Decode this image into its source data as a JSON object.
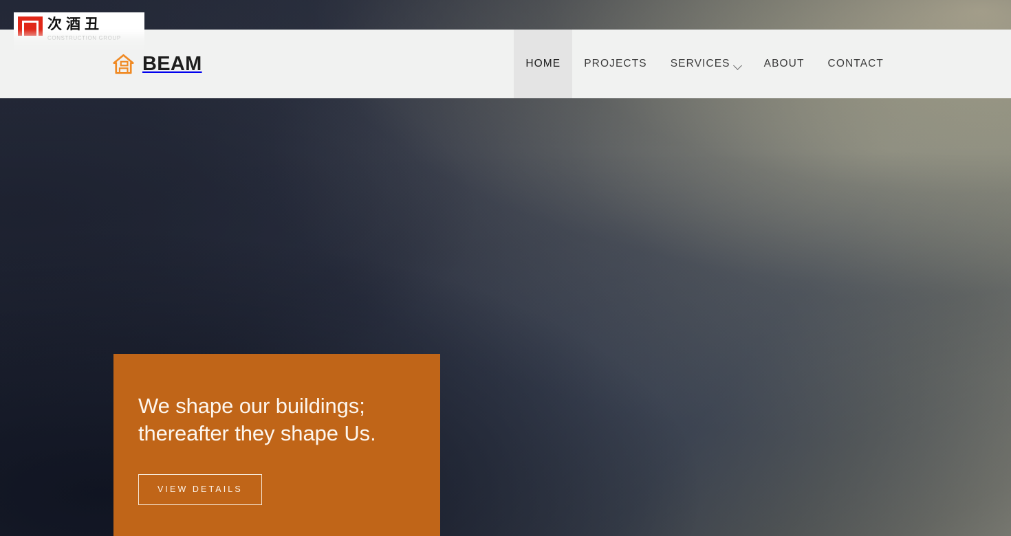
{
  "site": {
    "brand_name": "BEAM",
    "brand_icon": "house-icon"
  },
  "colors": {
    "accent_orange": "#c06518",
    "header_bg": "#f1f2f1",
    "nav_active_bg": "#e4e4e4",
    "hero_dark": "#262b3a",
    "overlay_mark_red": "#e02718"
  },
  "header": {
    "nav": [
      {
        "label": "HOME",
        "active": true,
        "has_dropdown": false
      },
      {
        "label": "PROJECTS",
        "active": false,
        "has_dropdown": false
      },
      {
        "label": "SERVICES",
        "active": false,
        "has_dropdown": true
      },
      {
        "label": "ABOUT",
        "active": false,
        "has_dropdown": false
      },
      {
        "label": "CONTACT",
        "active": false,
        "has_dropdown": false
      }
    ]
  },
  "overlay_logo": {
    "mark_icon": "red-square-logo-mark",
    "chinese_text": "次酒丑",
    "sub_text": "CONSTRUCTION GROUP"
  },
  "hero": {
    "heading_line_1": "We shape our buildings;",
    "heading_line_2": "thereafter they shape Us.",
    "cta_label": "VIEW DETAILS"
  }
}
